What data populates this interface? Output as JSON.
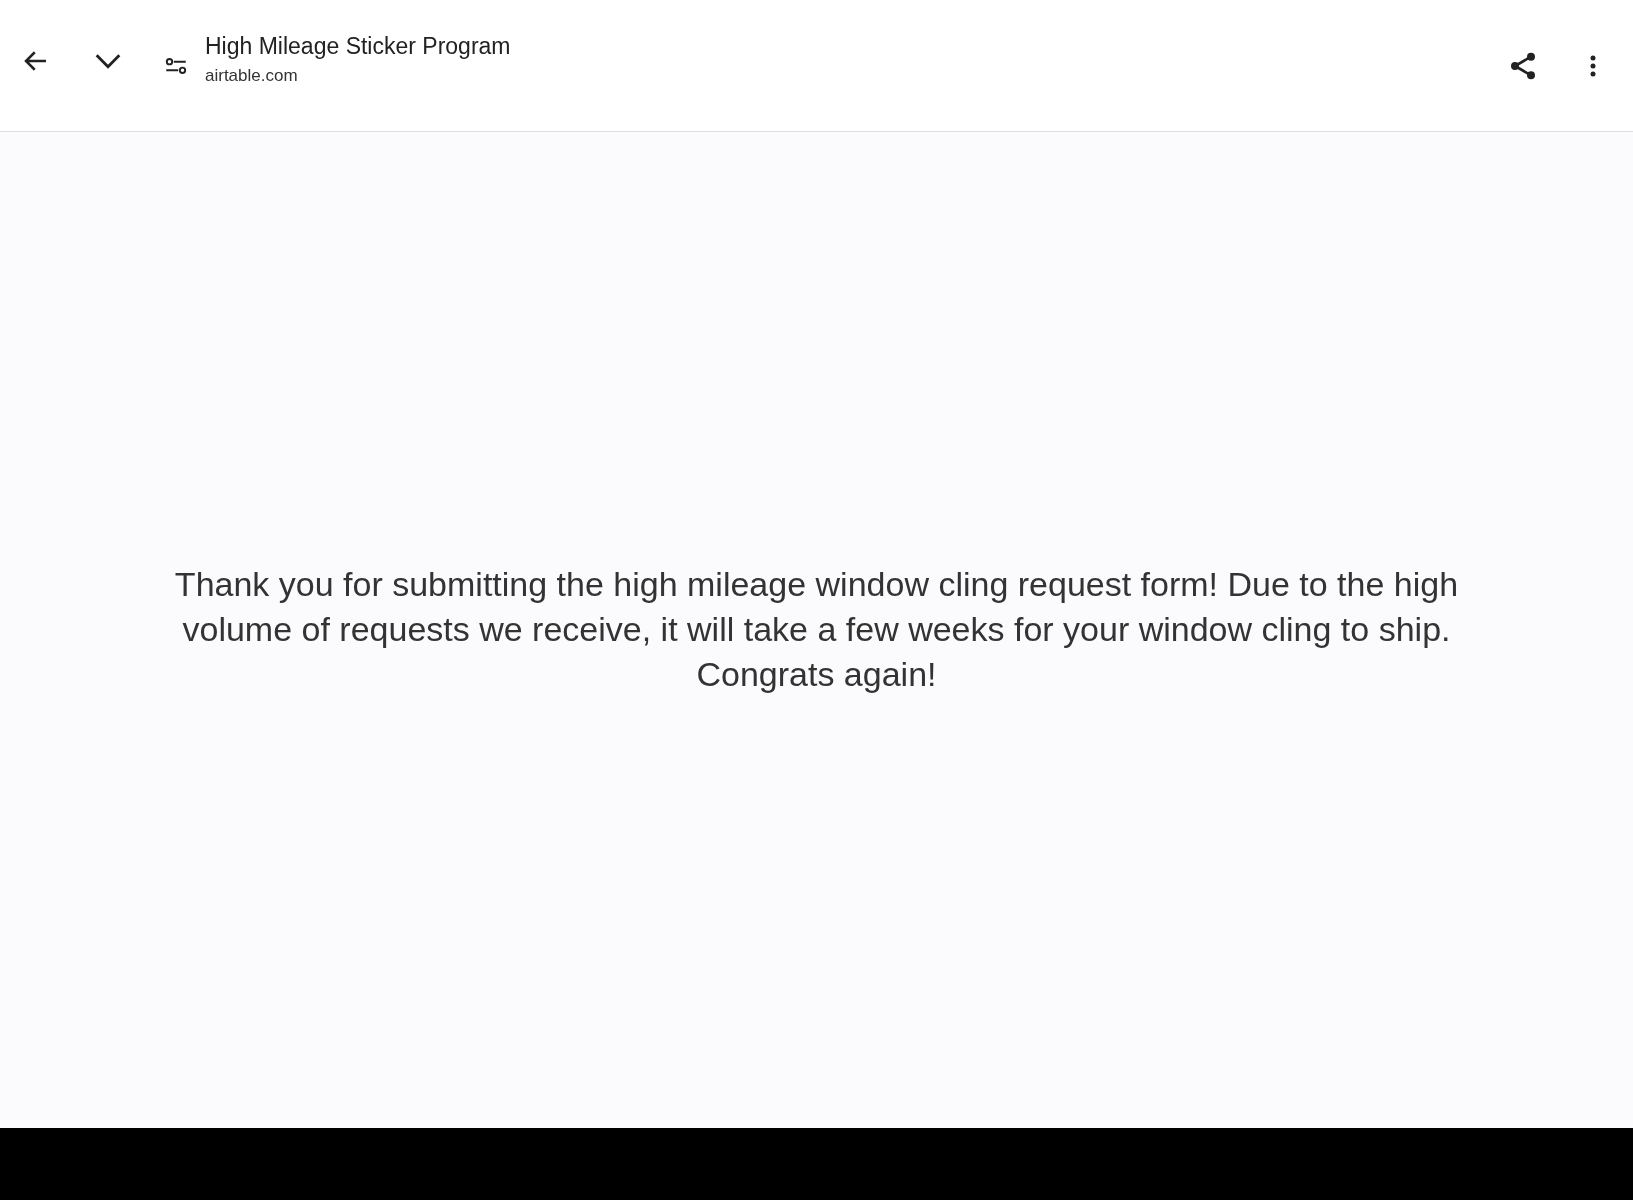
{
  "toolbar": {
    "title": "High Mileage Sticker Program",
    "url": "airtable.com"
  },
  "message": "Thank you for submitting the high mileage window cling request form! Due to the high volume of requests we receive, it will take a few weeks for your window cling to ship. Congrats again!"
}
